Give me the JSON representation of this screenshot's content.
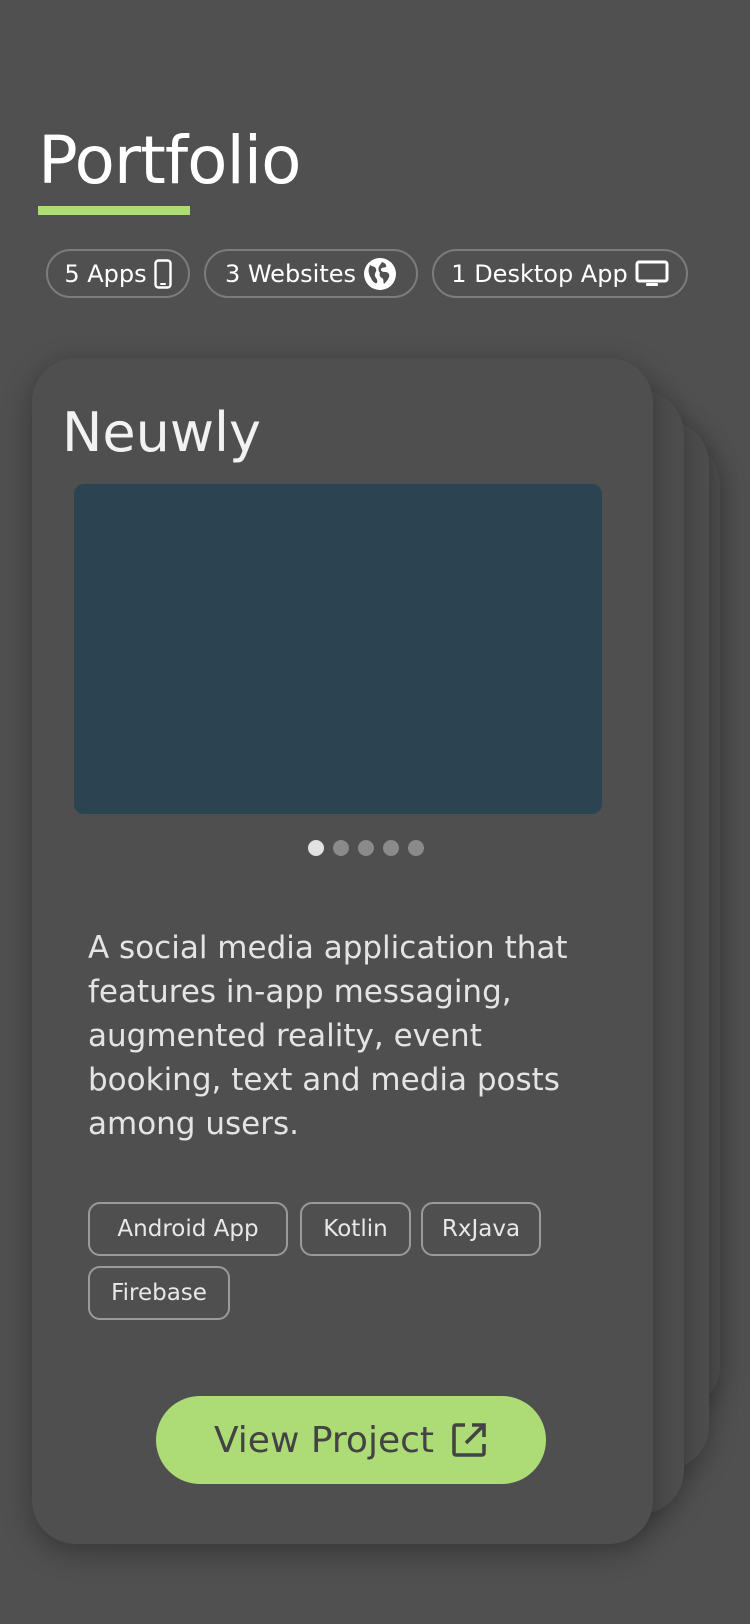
{
  "header": {
    "title": "Portfolio",
    "accent_color": "#addc77"
  },
  "stats": [
    {
      "label": "5 Apps",
      "icon": "smartphone-icon"
    },
    {
      "label": "3 Websites",
      "icon": "globe-icon"
    },
    {
      "label": "1 Desktop App",
      "icon": "monitor-icon"
    }
  ],
  "project": {
    "name": "Neuwly",
    "image_color": "#2c4351",
    "carousel": {
      "count": 5,
      "active": 1
    },
    "description": "A social media application that features in-app messaging, augmented reality, event booking, text and media posts among users.",
    "tags": [
      "Android App",
      "Kotlin",
      "RxJava",
      "Firebase"
    ],
    "button_label": "View Project",
    "button_icon": "external-link-icon"
  }
}
